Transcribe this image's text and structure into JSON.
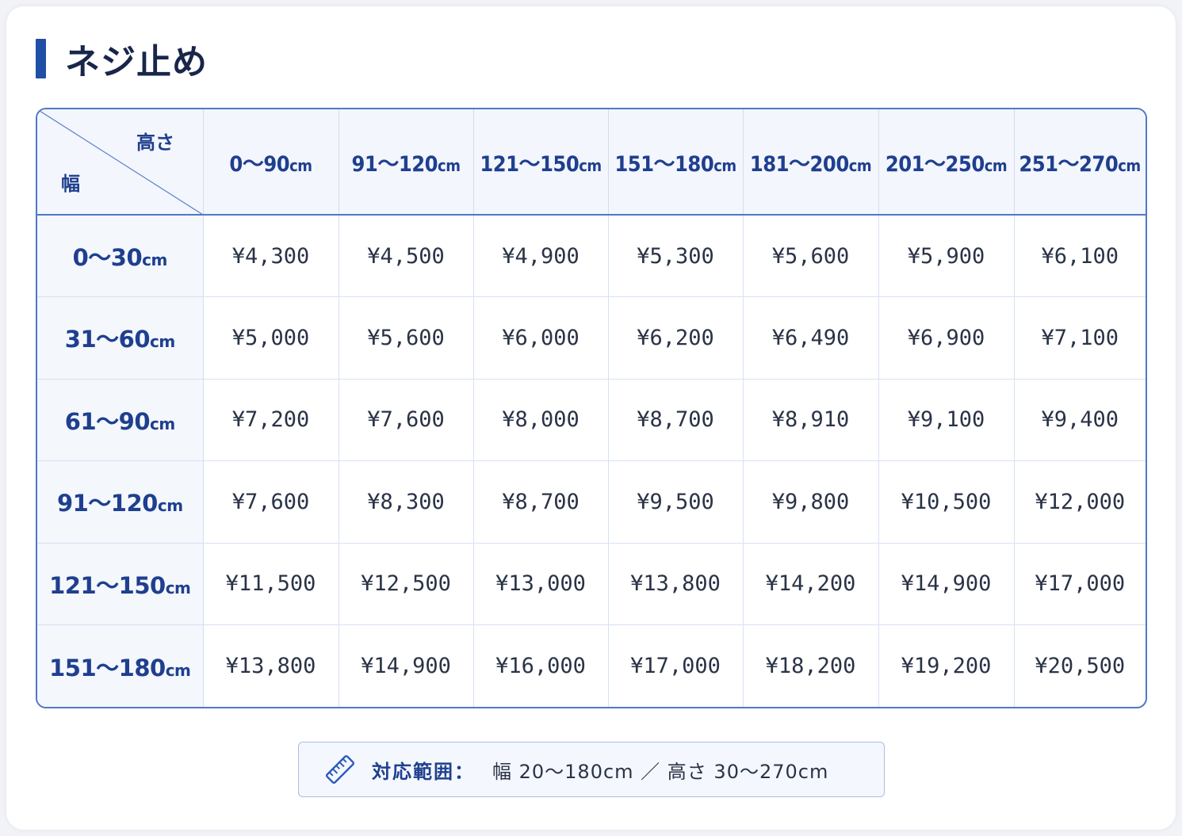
{
  "title": "ネジ止め",
  "table": {
    "corner_height_label": "高さ",
    "corner_width_label": "幅",
    "unit": "cm",
    "height_ranges": [
      "0～90",
      "91～120",
      "121～150",
      "151～180",
      "181～200",
      "201～250",
      "251～270"
    ],
    "width_ranges": [
      "0～30",
      "31～60",
      "61～90",
      "91～120",
      "121～150",
      "151～180"
    ],
    "prices": [
      [
        "¥4,300",
        "¥4,500",
        "¥4,900",
        "¥5,300",
        "¥5,600",
        "¥5,900",
        "¥6,100"
      ],
      [
        "¥5,000",
        "¥5,600",
        "¥6,000",
        "¥6,200",
        "¥6,490",
        "¥6,900",
        "¥7,100"
      ],
      [
        "¥7,200",
        "¥7,600",
        "¥8,000",
        "¥8,700",
        "¥8,910",
        "¥9,100",
        "¥9,400"
      ],
      [
        "¥7,600",
        "¥8,300",
        "¥8,700",
        "¥9,500",
        "¥9,800",
        "¥10,500",
        "¥12,000"
      ],
      [
        "¥11,500",
        "¥12,500",
        "¥13,000",
        "¥13,800",
        "¥14,200",
        "¥14,900",
        "¥17,000"
      ],
      [
        "¥13,800",
        "¥14,900",
        "¥16,000",
        "¥17,000",
        "¥18,200",
        "¥19,200",
        "¥20,500"
      ]
    ]
  },
  "range_note": {
    "icon": "ruler-icon",
    "label": "対応範囲：",
    "value": "幅 20～180cm ／ 高さ 30～270cm"
  },
  "colors": {
    "accent": "#1f4fa6",
    "border": "#4f78c9",
    "header_bg": "#f3f6fc",
    "text_dark": "#19264a"
  }
}
